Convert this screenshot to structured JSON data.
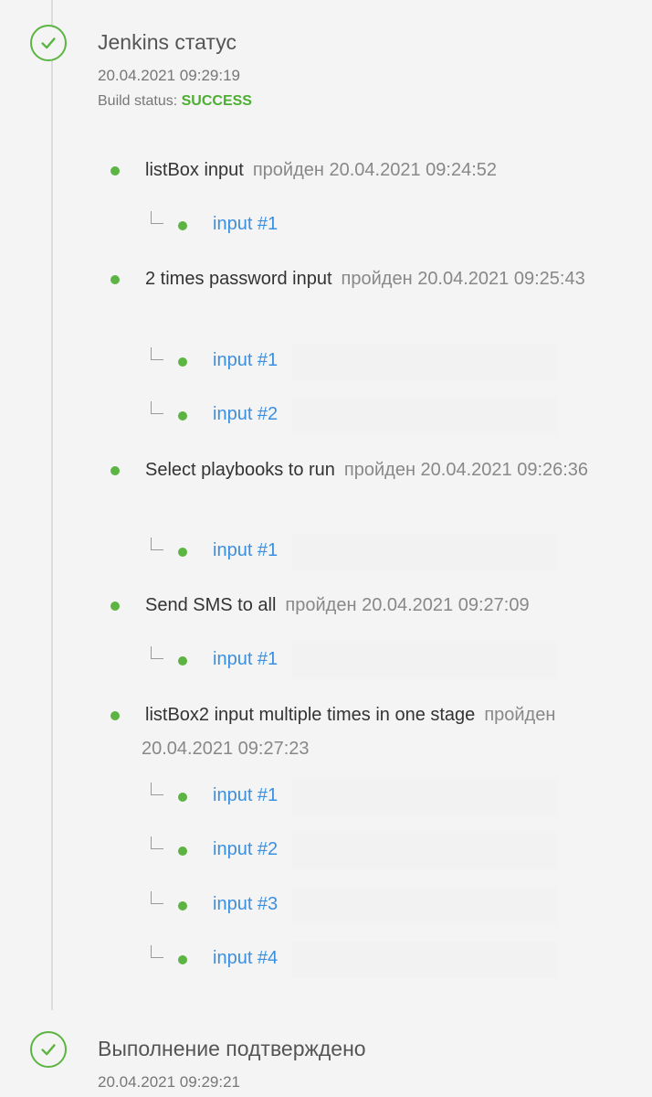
{
  "colors": {
    "success": "#5cb443",
    "link": "#3b8fe0",
    "background": "#f4f4f4"
  },
  "events": [
    {
      "icon": "check-circle-icon",
      "title": "Jenkins статус",
      "time": "20.04.2021 09:29:19",
      "build_status_label": "Build status:",
      "build_status_value": "SUCCESS"
    },
    {
      "icon": "check-circle-icon",
      "title": "Выполнение подтверждено",
      "time": "20.04.2021 09:29:21"
    }
  ],
  "stages": [
    {
      "name": "listBox input",
      "status": "пройден 20.04.2021 09:24:52",
      "inputs": [
        "input #1"
      ]
    },
    {
      "name": "2 times password input",
      "status": "пройден 20.04.2021 09:25:43",
      "inputs": [
        "input #1",
        "input #2"
      ]
    },
    {
      "name": "Select playbooks to run",
      "status": "пройден 20.04.2021 09:26:36",
      "inputs": [
        "input #1"
      ]
    },
    {
      "name": "Send SMS to all",
      "status": "пройден 20.04.2021 09:27:09",
      "inputs": [
        "input #1"
      ]
    },
    {
      "name": "listBox2 input multiple times in one stage",
      "status": "пройден 20.04.2021 09:27:23",
      "inputs": [
        "input #1",
        "input #2",
        "input #3",
        "input #4"
      ]
    }
  ]
}
